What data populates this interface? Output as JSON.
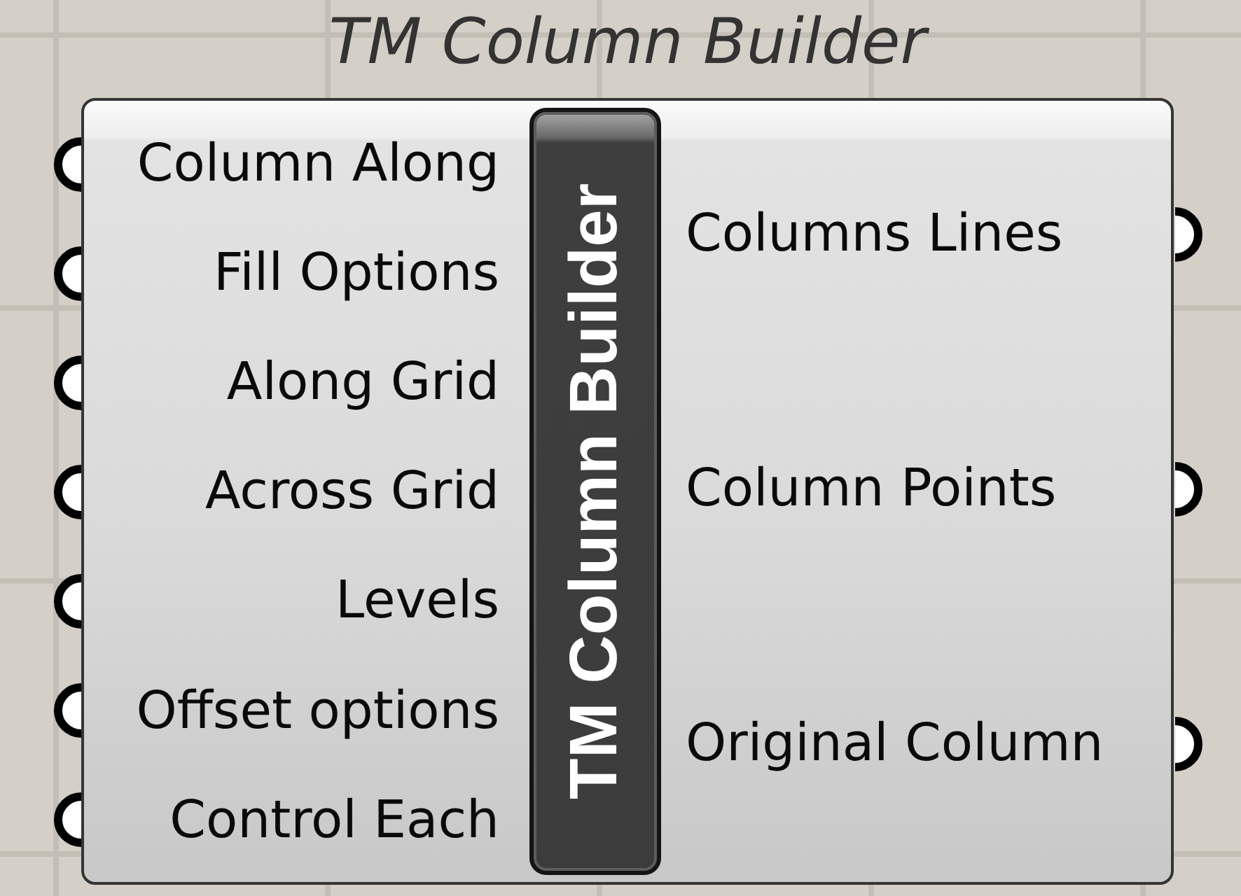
{
  "component": {
    "title": "TM Column Builder",
    "name": "TM Column Builder",
    "inputs": [
      {
        "label": "Column Along"
      },
      {
        "label": "Fill Options"
      },
      {
        "label": "Along Grid"
      },
      {
        "label": "Across Grid"
      },
      {
        "label": "Levels"
      },
      {
        "label": "Offset options"
      },
      {
        "label": "Control Each"
      }
    ],
    "outputs": [
      {
        "label": "Columns Lines"
      },
      {
        "label": "Column Points"
      },
      {
        "label": "Original Column"
      }
    ]
  }
}
